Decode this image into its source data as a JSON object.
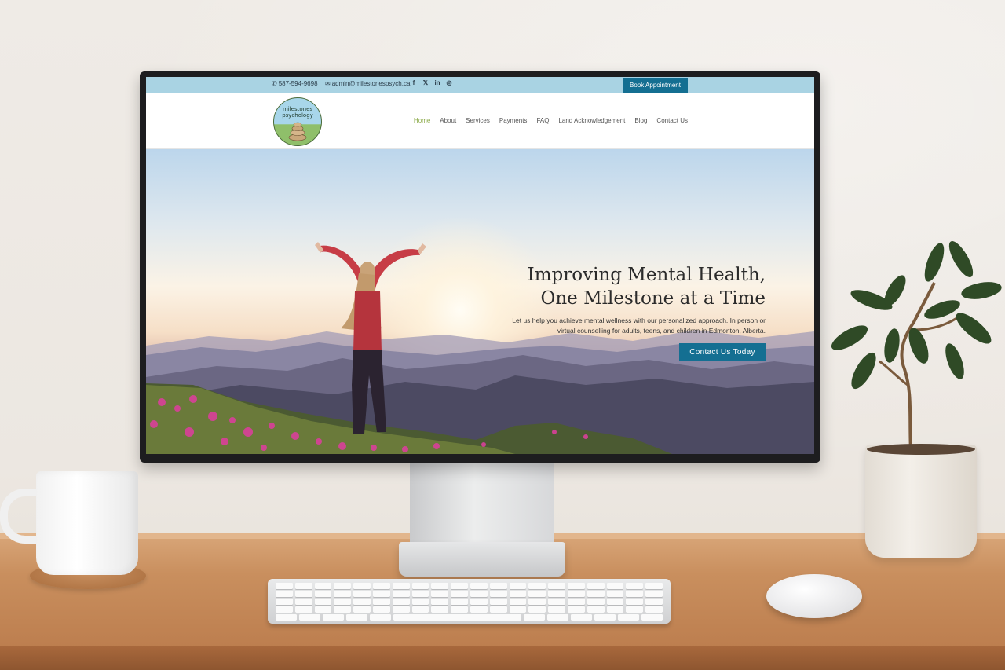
{
  "topbar": {
    "phone": "587-594-9698",
    "email": "admin@milestonespsych.ca",
    "social": [
      {
        "name": "facebook-icon",
        "glyph": "f"
      },
      {
        "name": "x-icon",
        "glyph": "𝕏"
      },
      {
        "name": "linkedin-icon",
        "glyph": "in"
      },
      {
        "name": "instagram-icon",
        "glyph": "◎"
      }
    ],
    "book_label": "Book Appointment"
  },
  "header": {
    "logo_text_line1": "milestones",
    "logo_text_line2": "psychology",
    "nav": {
      "home": "Home",
      "about": "About",
      "services": "Services",
      "payments": "Payments",
      "faq": "FAQ",
      "land": "Land Acknowledgement",
      "blog": "Blog",
      "contact": "Contact Us"
    },
    "active_color": "#8cab4a"
  },
  "hero": {
    "title_line1": "Improving Mental Health,",
    "title_line2": "One Milestone at a Time",
    "subtitle_line1": "Let us help you achieve mental wellness with our personalized approach. In person or",
    "subtitle_line2": "virtual counselling for adults, teens, and children in Edmonton, Alberta.",
    "cta_label": "Contact Us Today"
  },
  "colors": {
    "topbar_bg": "#a9d3e3",
    "accent": "#146f92"
  }
}
